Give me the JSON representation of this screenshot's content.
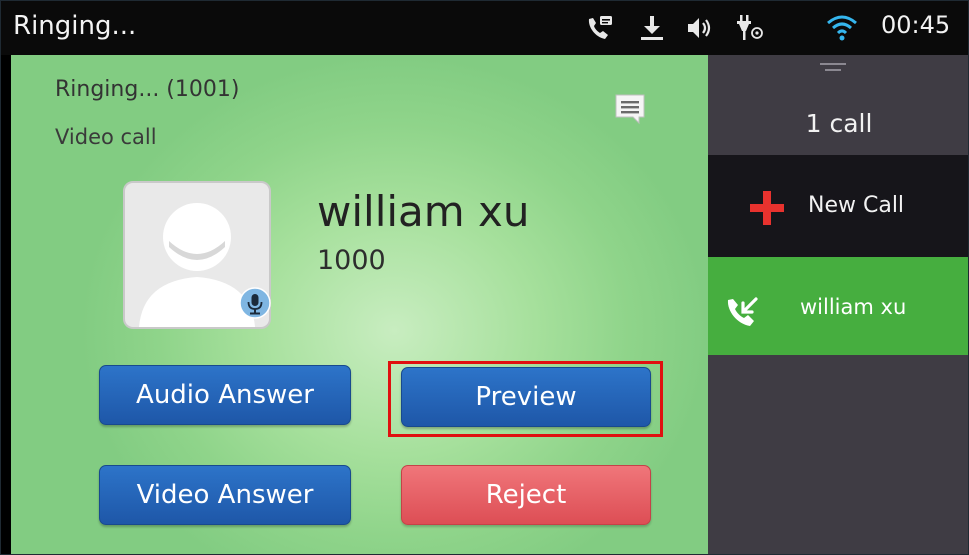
{
  "status_bar": {
    "title": "Ringing...",
    "time": "00:45",
    "icons": [
      "voicemail-phone-icon",
      "download-icon",
      "volume-icon",
      "usb-debug-icon",
      "wifi-icon"
    ]
  },
  "call_screen": {
    "status_line": "Ringing... (1001)",
    "call_type": "Video call",
    "contact_name": "william xu",
    "contact_number": "1000",
    "buttons": {
      "audio_answer": "Audio Answer",
      "preview": "Preview",
      "video_answer": "Video Answer",
      "reject": "Reject"
    }
  },
  "call_panel": {
    "calls_count": "1 call",
    "new_call": "New Call",
    "active_call_name": "william xu"
  },
  "colors": {
    "accent_blue": "#2465b8",
    "reject_red": "#e55d63",
    "active_green": "#46ae3f",
    "highlight_red": "#e01010"
  }
}
